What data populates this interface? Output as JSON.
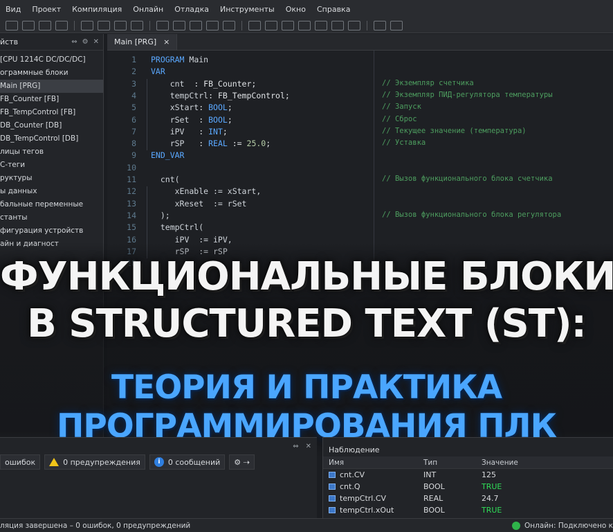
{
  "menu": [
    "Вид",
    "Проект",
    "Компиляция",
    "Онлайн",
    "Отладка",
    "Инструменты",
    "Окно",
    "Справка"
  ],
  "sidebar": {
    "title": "йств",
    "icons": [
      "pin-icon",
      "gear-icon",
      "close-icon"
    ],
    "items": [
      "[CPU 1214C DC/DC/DC]",
      "ограммные блоки",
      "Main [PRG]",
      "FB_Counter [FB]",
      "FB_TempControl [FB]",
      "DB_Counter [DB]",
      "DB_TempControl [DB]",
      "лицы тегов",
      "С-теги",
      "руктуры",
      "ы данных",
      "бальные переменные",
      "станты",
      "фигурация устройств",
      "айн и диагност"
    ]
  },
  "editor": {
    "tab": "Main [PRG]",
    "close": "×",
    "line_numbers": [
      "1",
      "2",
      "3",
      "4",
      "5",
      "6",
      "7",
      "8",
      "9",
      "10",
      "11",
      "12",
      "13",
      "14",
      "15",
      "16",
      "17",
      "18"
    ],
    "lines": [
      [
        [
          "kw",
          "PROGRAM"
        ],
        [
          "id",
          " Main"
        ]
      ],
      [
        [
          "kw",
          "VAR"
        ]
      ],
      [
        [
          "id",
          "    cnt  "
        ],
        [
          "ty",
          ": FB_Counter;"
        ]
      ],
      [
        [
          "id",
          "    tempCtrl"
        ],
        [
          "ty",
          ": FB_TempControl;"
        ]
      ],
      [
        [
          "id",
          "    xStart"
        ],
        [
          "ty",
          ": "
        ],
        [
          "kw",
          "BOOL"
        ],
        [
          "ty",
          ";"
        ]
      ],
      [
        [
          "id",
          "    rSet  "
        ],
        [
          "ty",
          ": "
        ],
        [
          "kw",
          "BOOL"
        ],
        [
          "ty",
          ";"
        ]
      ],
      [
        [
          "id",
          "    iPV   "
        ],
        [
          "ty",
          ": "
        ],
        [
          "kw",
          "INT"
        ],
        [
          "ty",
          ";"
        ]
      ],
      [
        [
          "id",
          "    rSP   "
        ],
        [
          "ty",
          ": "
        ],
        [
          "kw",
          "REAL"
        ],
        [
          "ty",
          " := "
        ],
        [
          "num",
          "25.0"
        ],
        [
          "ty",
          ";"
        ]
      ],
      [
        [
          "kw",
          "END_VAR"
        ]
      ],
      [],
      [
        [
          "id",
          "  cnt("
        ]
      ],
      [
        [
          "id",
          "     xEnable := xStart,"
        ]
      ],
      [
        [
          "id",
          "     xReset  := rSet"
        ]
      ],
      [
        [
          "id",
          "  );"
        ]
      ],
      [
        [
          "id",
          "  tempCtrl("
        ]
      ],
      [
        [
          "id",
          "     iPV  := iPV,"
        ]
      ],
      [
        [
          "id",
          "     rSP  := rSP"
        ]
      ],
      []
    ],
    "comments": [
      {
        "line": 3,
        "text": "// Экземпляр счетчика"
      },
      {
        "line": 4,
        "text": "// Экземпляр ПИД-регулятора температуры"
      },
      {
        "line": 5,
        "text": "// Запуск"
      },
      {
        "line": 6,
        "text": "// Сброс"
      },
      {
        "line": 7,
        "text": "// Текущее значение (температура)"
      },
      {
        "line": 8,
        "text": "// Уставка"
      },
      {
        "line": 11,
        "text": "// Вызов функционального блока счетчика"
      },
      {
        "line": 14,
        "text": "// Вызов функционального блока регулятора"
      }
    ]
  },
  "overlay": {
    "line1": "ФУНКЦИОНАЛЬНЫЕ БЛОКИ",
    "line2": "В STRUCTURED TEXT (ST):",
    "line3": "ТЕОРИЯ И ПРАКТИКА",
    "line4": "ПРОГРАММИРОВАНИЯ ПЛК"
  },
  "output": {
    "errors": "ошибок",
    "warnings": "0 предупреждения",
    "messages": "0 сообщений"
  },
  "watch": {
    "title": "Наблюдение",
    "headers": [
      "Имя",
      "Тип",
      "Значение"
    ],
    "rows": [
      {
        "name": "cnt.CV",
        "type": "INT",
        "value": "125"
      },
      {
        "name": "cnt.Q",
        "type": "BOOL",
        "value": "TRUE"
      },
      {
        "name": "tempCtrl.CV",
        "type": "REAL",
        "value": "24.7"
      },
      {
        "name": "tempCtrl.xOut",
        "type": "BOOL",
        "value": "TRUE"
      }
    ]
  },
  "status": {
    "left": "ляция завершена – 0 ошибок, 0 предупреждений",
    "right": "Онлайн: Подключено к"
  },
  "colors": {
    "keyword": "#5aa8ff",
    "comment": "#4d9e5f",
    "true": "#2fdc57",
    "overlay_blue": "#4aa6ff"
  }
}
